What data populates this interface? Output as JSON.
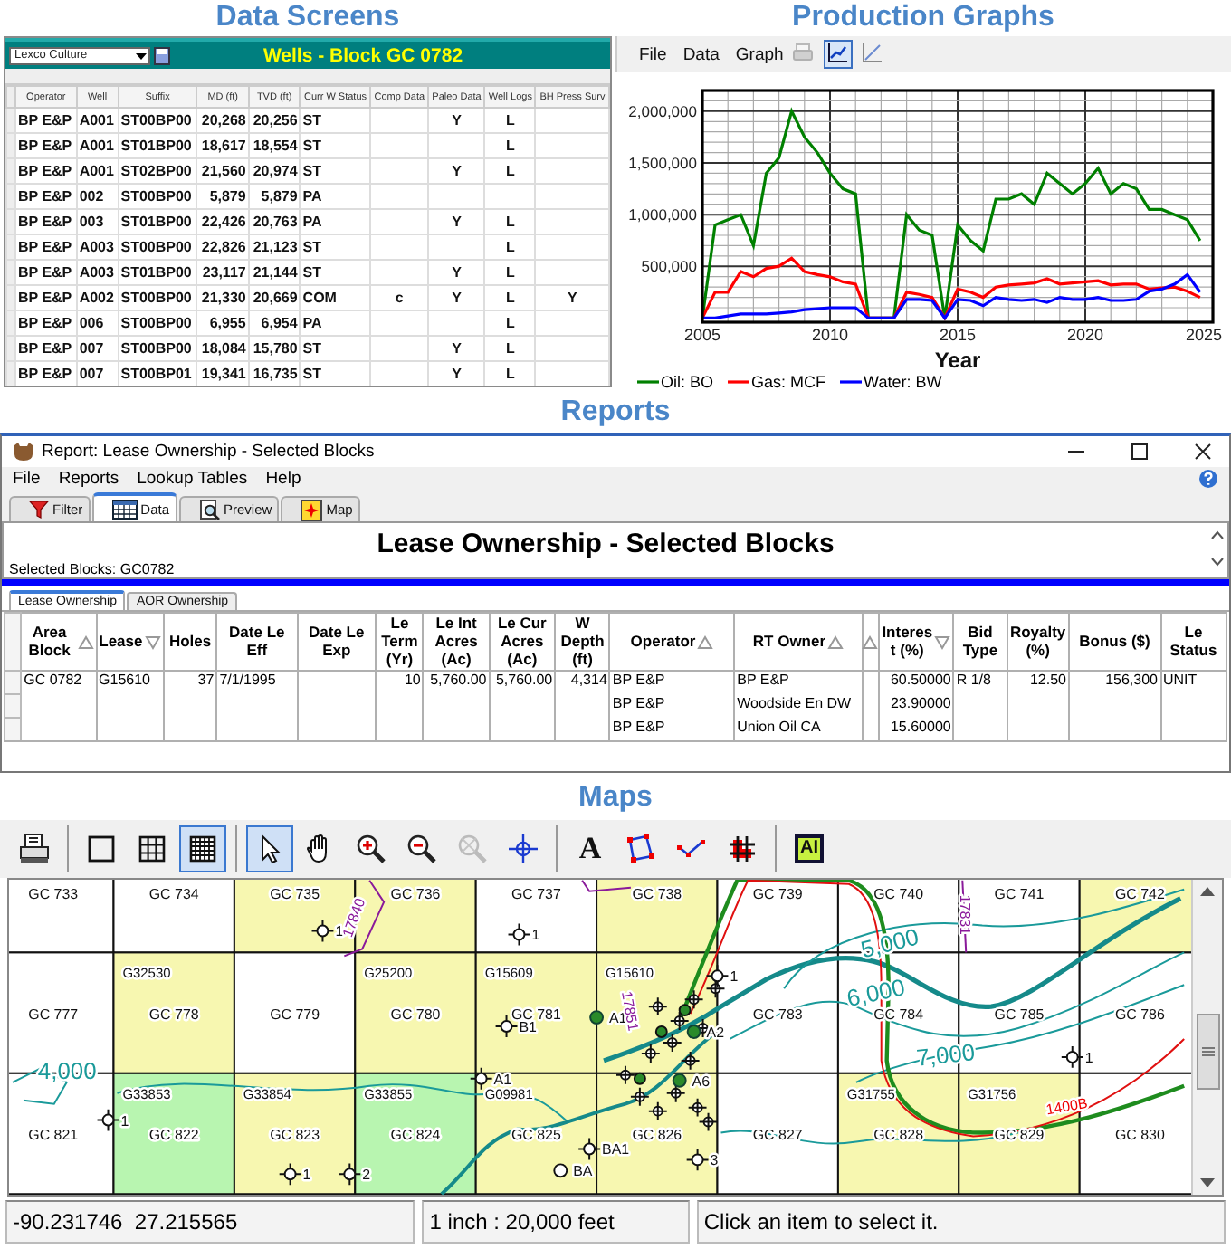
{
  "data_screen": {
    "heading": "Data Screens",
    "dropdown": {
      "value": "Lexco Culture"
    },
    "title": "Wells - Block GC 0782",
    "columns": [
      "Operator",
      "Well",
      "Suffix",
      "MD (ft)",
      "TVD (ft)",
      "Curr W Status",
      "Comp Data",
      "Paleo Data",
      "Well Logs",
      "BH Press Surv"
    ],
    "rows": [
      {
        "operator": "BP E&P",
        "well": "A001",
        "suffix": "ST00BP00",
        "md": "20,268",
        "tvd": "20,256",
        "status": "ST",
        "paleo": "Y",
        "logs": "L"
      },
      {
        "operator": "BP E&P",
        "well": "A001",
        "suffix": "ST01BP00",
        "md": "18,617",
        "tvd": "18,554",
        "status": "ST",
        "logs": "L"
      },
      {
        "operator": "BP E&P",
        "well": "A001",
        "suffix": "ST02BP00",
        "md": "21,560",
        "tvd": "20,974",
        "status": "ST",
        "paleo": "Y",
        "logs": "L"
      },
      {
        "operator": "BP E&P",
        "well": "002",
        "suffix": "ST00BP00",
        "md": "5,879",
        "tvd": "5,879",
        "status": "PA"
      },
      {
        "operator": "BP E&P",
        "well": "003",
        "suffix": "ST01BP00",
        "md": "22,426",
        "tvd": "20,763",
        "status": "PA",
        "paleo": "Y",
        "logs": "L"
      },
      {
        "operator": "BP E&P",
        "well": "A003",
        "suffix": "ST00BP00",
        "md": "22,826",
        "tvd": "21,123",
        "status": "ST",
        "logs": "L"
      },
      {
        "operator": "BP E&P",
        "well": "A003",
        "suffix": "ST01BP00",
        "md": "23,117",
        "tvd": "21,144",
        "status": "ST",
        "paleo": "Y",
        "logs": "L"
      },
      {
        "operator": "BP E&P",
        "well": "A002",
        "suffix": "ST00BP00",
        "md": "21,330",
        "tvd": "20,669",
        "status": "COM",
        "comp": "c",
        "paleo": "Y",
        "logs": "L",
        "bh": "Y"
      },
      {
        "operator": "BP E&P",
        "well": "006",
        "suffix": "ST00BP00",
        "md": "6,955",
        "tvd": "6,954",
        "status": "PA",
        "logs": "L"
      },
      {
        "operator": "BP E&P",
        "well": "007",
        "suffix": "ST00BP00",
        "md": "18,084",
        "tvd": "15,780",
        "status": "ST",
        "paleo": "Y",
        "logs": "L"
      },
      {
        "operator": "BP E&P",
        "well": "007",
        "suffix": "ST00BP01",
        "md": "19,341",
        "tvd": "16,735",
        "status": "ST",
        "paleo": "Y",
        "logs": "L"
      }
    ]
  },
  "production_graph": {
    "heading": "Production Graphs",
    "menu": [
      "File",
      "Data",
      "Graph"
    ],
    "tools": [
      {
        "kind": "print",
        "selected": false,
        "disabled": true
      },
      {
        "kind": "chart",
        "selected": true,
        "disabled": false
      },
      {
        "kind": "chart-alt",
        "selected": false,
        "disabled": false
      }
    ],
    "chart_data": {
      "type": "line",
      "xlabel": "Year",
      "grid": true,
      "xlim": [
        2005,
        2025
      ],
      "ylim": [
        -40000,
        2200000
      ],
      "xticks": [
        2005,
        2010,
        2015,
        2020,
        2025
      ],
      "yticks": [
        {
          "value": 500000,
          "label": "500,000"
        },
        {
          "value": 1000000,
          "label": "1,000,000"
        },
        {
          "value": 1500000,
          "label": "1,500,000"
        },
        {
          "value": 2000000,
          "label": "2,000,000"
        }
      ],
      "x": [
        2005,
        2005.5,
        2006,
        2006.5,
        2007,
        2007.5,
        2008,
        2008.5,
        2009,
        2009.5,
        2010,
        2010.5,
        2011,
        2011.5,
        2012,
        2012.5,
        2013,
        2013.5,
        2014,
        2014.5,
        2015,
        2015.5,
        2016,
        2016.5,
        2017,
        2017.5,
        2018,
        2018.5,
        2019,
        2019.5,
        2020,
        2020.5,
        2021,
        2021.5,
        2022,
        2022.5,
        2023,
        2023.5,
        2024,
        2024.5
      ],
      "series": [
        {
          "name": "Oil: BO",
          "color": "#008000",
          "values": [
            0,
            900000,
            950000,
            1000000,
            700000,
            1400000,
            1550000,
            2000000,
            1750000,
            1600000,
            1400000,
            1250000,
            1200000,
            0,
            0,
            0,
            1000000,
            850000,
            800000,
            0,
            900000,
            750000,
            650000,
            1150000,
            1150000,
            1200000,
            1100000,
            1400000,
            1300000,
            1200000,
            1300000,
            1450000,
            1200000,
            1300000,
            1250000,
            1050000,
            1050000,
            1000000,
            950000,
            750000
          ]
        },
        {
          "name": "Gas: MCF",
          "color": "#ff0000",
          "values": [
            0,
            250000,
            250000,
            450000,
            400000,
            480000,
            500000,
            580000,
            450000,
            420000,
            400000,
            350000,
            330000,
            0,
            0,
            0,
            250000,
            230000,
            200000,
            0,
            280000,
            250000,
            200000,
            300000,
            320000,
            330000,
            340000,
            380000,
            330000,
            340000,
            350000,
            360000,
            320000,
            330000,
            330000,
            280000,
            290000,
            300000,
            260000,
            200000
          ]
        },
        {
          "name": "Water: BW",
          "color": "#0000ff",
          "values": [
            0,
            0,
            20000,
            40000,
            40000,
            40000,
            50000,
            60000,
            80000,
            90000,
            100000,
            100000,
            100000,
            0,
            0,
            0,
            180000,
            180000,
            170000,
            0,
            180000,
            170000,
            120000,
            200000,
            180000,
            170000,
            180000,
            150000,
            200000,
            180000,
            180000,
            200000,
            170000,
            170000,
            180000,
            260000,
            280000,
            330000,
            420000,
            250000
          ]
        }
      ]
    }
  },
  "report": {
    "heading": "Reports",
    "window_title": "Report: Lease Ownership - Selected Blocks",
    "menu": [
      "File",
      "Reports",
      "Lookup Tables",
      "Help"
    ],
    "tabs": [
      {
        "label": "Filter",
        "kind": "filter",
        "selected": false
      },
      {
        "label": "Data",
        "kind": "data",
        "selected": true
      },
      {
        "label": "Preview",
        "kind": "preview",
        "selected": false
      },
      {
        "label": "Map",
        "kind": "map",
        "selected": false
      }
    ],
    "report_title": "Lease Ownership - Selected Blocks",
    "subtitle": "Selected Blocks: GC0782",
    "subtabs": [
      {
        "label": "Lease Ownership",
        "selected": true
      },
      {
        "label": "AOR Ownership",
        "selected": false
      }
    ],
    "table": {
      "columns": [
        {
          "label": "Area Block",
          "sorted": true,
          "descending": false
        },
        {
          "label": "Lease",
          "sorted": true,
          "descending": true
        },
        {
          "label": "Holes",
          "sorted": false
        },
        {
          "label": "Date Le Eff",
          "sorted": false
        },
        {
          "label": "Date Le Exp",
          "sorted": false
        },
        {
          "label": "Le Term (Yr)",
          "sorted": false
        },
        {
          "label": "Le Int Acres (Ac)",
          "sorted": false
        },
        {
          "label": "Le Cur Acres (Ac)",
          "sorted": false
        },
        {
          "label": "W Depth (ft)",
          "sorted": false
        },
        {
          "label": "Operator",
          "sorted": true,
          "descending": false
        },
        {
          "label": "RT Owner",
          "sorted": true,
          "descending": false
        },
        {
          "sorted": true,
          "descending": false
        },
        {
          "label": "Interest (%)",
          "sorted": true,
          "descending": true
        },
        {
          "label": "Bid Type",
          "sorted": false
        },
        {
          "label": "Royalty (%)",
          "sorted": false
        },
        {
          "label": "Bonus ($)",
          "sorted": false
        },
        {
          "label": "Le Status",
          "sorted": false
        }
      ],
      "rows": [
        {
          "area_block": "GC 0782",
          "lease": "G15610",
          "holes": "37",
          "date_le_eff": "7/1/1995",
          "le_term": "10",
          "le_int_acres": "5,760.00",
          "le_cur_acres": "5,760.00",
          "w_depth": "4,314",
          "operator": "BP E&P",
          "rt_owner": "BP E&P",
          "interest": "60.50000",
          "bid_type": "R 1/8",
          "royalty": "12.50",
          "bonus": "156,300",
          "le_status": "UNIT"
        },
        {
          "operator": "BP E&P",
          "rt_owner": "Woodside En DW",
          "interest": "23.90000"
        },
        {
          "operator": "BP E&P",
          "rt_owner": "Union Oil CA",
          "interest": "15.60000"
        }
      ]
    }
  },
  "map": {
    "heading": "Maps",
    "toolbar": [
      [
        {
          "kind": "print",
          "selected": false,
          "disabled": false
        }
      ],
      [
        {
          "kind": "frame",
          "selected": false,
          "disabled": false
        },
        {
          "kind": "grid",
          "selected": false,
          "disabled": false
        },
        {
          "kind": "fine-grid",
          "selected": true,
          "disabled": false
        }
      ],
      [
        {
          "kind": "pointer",
          "selected": true,
          "disabled": false
        },
        {
          "kind": "pan",
          "selected": false,
          "disabled": false
        },
        {
          "kind": "zoom-in",
          "selected": false,
          "disabled": false
        },
        {
          "kind": "zoom-out",
          "selected": false,
          "disabled": false
        },
        {
          "kind": "zoom-extent",
          "selected": false,
          "disabled": true
        },
        {
          "kind": "crosshair",
          "selected": false,
          "disabled": false
        }
      ],
      [
        {
          "kind": "text",
          "glyph": "A",
          "selected": false,
          "disabled": false
        },
        {
          "kind": "polygon",
          "selected": false,
          "disabled": false
        },
        {
          "kind": "line",
          "selected": false,
          "disabled": false
        },
        {
          "kind": "grid-select",
          "selected": false,
          "disabled": false
        }
      ],
      [
        {
          "kind": "label",
          "glyph": "AI",
          "selected": false,
          "disabled": false
        }
      ]
    ],
    "blocks": [
      [
        {
          "label": "GC 733",
          "color": "#ffffff"
        },
        {
          "label": "GC 734",
          "color": "#ffffff"
        },
        {
          "label": "GC 735",
          "color": "#f7f7b0"
        },
        {
          "label": "GC 736",
          "color": "#f7f7b0"
        },
        {
          "label": "GC 737",
          "color": "#ffffff"
        },
        {
          "label": "GC 738",
          "color": "#f7f7b0"
        },
        {
          "label": "GC 739",
          "color": "#ffffff"
        },
        {
          "label": "GC 740",
          "color": "#ffffff"
        },
        {
          "label": "GC 741",
          "color": "#ffffff"
        },
        {
          "label": "GC 742",
          "color": "#f7f7b0"
        }
      ],
      [
        {
          "label": "GC 777",
          "color": "#ffffff"
        },
        {
          "label": "GC 778",
          "lease": "G32530",
          "color": "#f7f7b0"
        },
        {
          "label": "GC 779",
          "color": "#ffffff"
        },
        {
          "label": "GC 780",
          "lease": "G25200",
          "color": "#f7f7b0"
        },
        {
          "label": "GC 781",
          "lease": "G15609",
          "color": "#f7f7b0"
        },
        {
          "lease": "G15610",
          "color": "#f7f7b0"
        },
        {
          "label": "GC 783",
          "color": "#ffffff"
        },
        {
          "label": "GC 784",
          "color": "#ffffff"
        },
        {
          "label": "GC 785",
          "color": "#ffffff"
        },
        {
          "label": "GC 786",
          "color": "#ffffff"
        }
      ],
      [
        {
          "label": "GC 821",
          "color": "#ffffff"
        },
        {
          "label": "GC 822",
          "lease": "G33853",
          "color": "#b8f5b0"
        },
        {
          "label": "GC 823",
          "lease": "G33854",
          "color": "#f7f7b0"
        },
        {
          "label": "GC 824",
          "lease": "G33855",
          "color": "#b8f5b0"
        },
        {
          "label": "GC 825",
          "lease": "G09981",
          "color": "#f7f7b0"
        },
        {
          "label": "GC 826",
          "color": "#f7f7b0"
        },
        {
          "label": "GC 827",
          "color": "#ffffff"
        },
        {
          "label": "GC 828",
          "lease": "G31755",
          "color": "#f7f7b0"
        },
        {
          "label": "GC 829",
          "lease": "G31756",
          "color": "#f7f7b0"
        },
        {
          "label": "GC 830",
          "color": "#ffffff"
        }
      ]
    ],
    "wells": [
      {
        "label": "1",
        "kind": "crosshair"
      },
      {
        "label": "1",
        "kind": "crosshair"
      },
      {
        "label": "1",
        "kind": "crosshair"
      },
      {
        "label": "B1",
        "kind": "crosshair"
      },
      {
        "label": "A1",
        "kind": "dot"
      },
      {
        "label": "A2",
        "kind": "dot"
      },
      {
        "label": "1",
        "kind": "crosshair"
      },
      {
        "label": "A1",
        "kind": "crosshair"
      },
      {
        "label": "A6",
        "kind": "dot"
      },
      {
        "label": "1",
        "kind": "crosshair"
      },
      {
        "label": "1",
        "kind": "crosshair"
      },
      {
        "label": "2",
        "kind": "crosshair"
      },
      {
        "label": "BA",
        "kind": "circle"
      },
      {
        "label": "BA1",
        "kind": "crosshair"
      },
      {
        "label": "3",
        "kind": "crosshair"
      }
    ],
    "contour_labels": [
      {
        "text": "5,000",
        "kind": "contour"
      },
      {
        "text": "6,000",
        "kind": "contour"
      },
      {
        "text": "7,000",
        "kind": "contour"
      },
      {
        "text": "4,000",
        "kind": "contour"
      },
      {
        "text": "1400B",
        "kind": "lease"
      },
      {
        "text": "17840",
        "kind": "boundary"
      },
      {
        "text": "17831",
        "kind": "boundary"
      },
      {
        "text": "17851",
        "kind": "boundary"
      }
    ],
    "status_bar": [
      "-90.231746  27.215565",
      "1 inch : 20,000 feet",
      "Click an item to select it."
    ]
  }
}
